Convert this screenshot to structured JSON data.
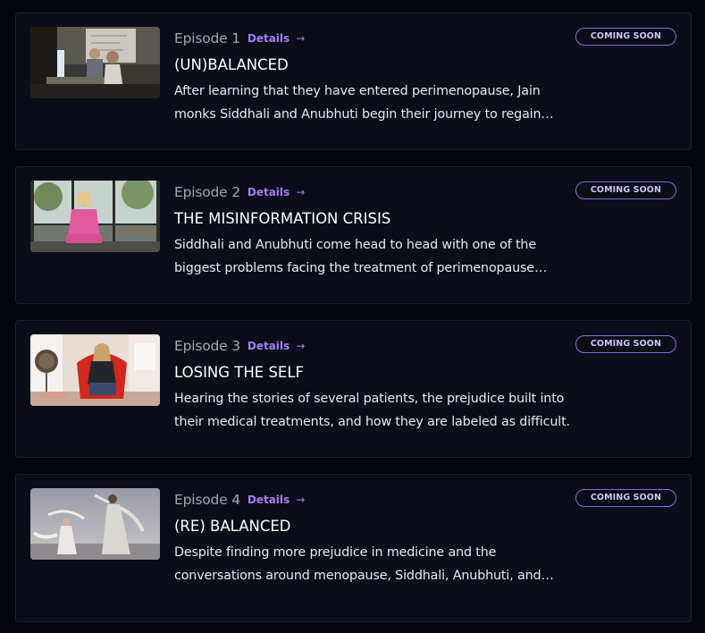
{
  "episodes": [
    {
      "episode_label": "Episode 1",
      "details_label": "Details",
      "title": "(UN)BALANCED",
      "description": "After learning that they have entered perimenopause, Jain monks Siddhali and Anubhuti begin their journey to regain balance in their lives.",
      "badge": "COMING SOON",
      "thumbnail_icon": "office-scene-thumbnail"
    },
    {
      "episode_label": "Episode 2",
      "details_label": "Details",
      "title": "THE MISINFORMATION CRISIS",
      "description": "Siddhali and Anubhuti come head to head with one of the biggest problems facing the treatment of perimenopause today.",
      "badge": "COMING SOON",
      "thumbnail_icon": "interview-window-thumbnail"
    },
    {
      "episode_label": "Episode 3",
      "details_label": "Details",
      "title": "LOSING THE SELF",
      "description": "Hearing the stories of several patients, the prejudice built into their medical treatments, and how they are labeled as difficult.",
      "badge": "COMING SOON",
      "thumbnail_icon": "red-chair-interview-thumbnail"
    },
    {
      "episode_label": "Episode 4",
      "details_label": "Details",
      "title": "(RE) BALANCED",
      "description": "Despite finding more prejudice in medicine and the conversations around menopause, Siddhali, Anubhuti, and their doctors find hope.",
      "badge": "COMING SOON",
      "thumbnail_icon": "dancers-thumbnail"
    }
  ],
  "colors": {
    "background": "#05060d",
    "card": "#0b0e18",
    "accent": "#a47cf2",
    "badge_border": "#8a67e6"
  }
}
